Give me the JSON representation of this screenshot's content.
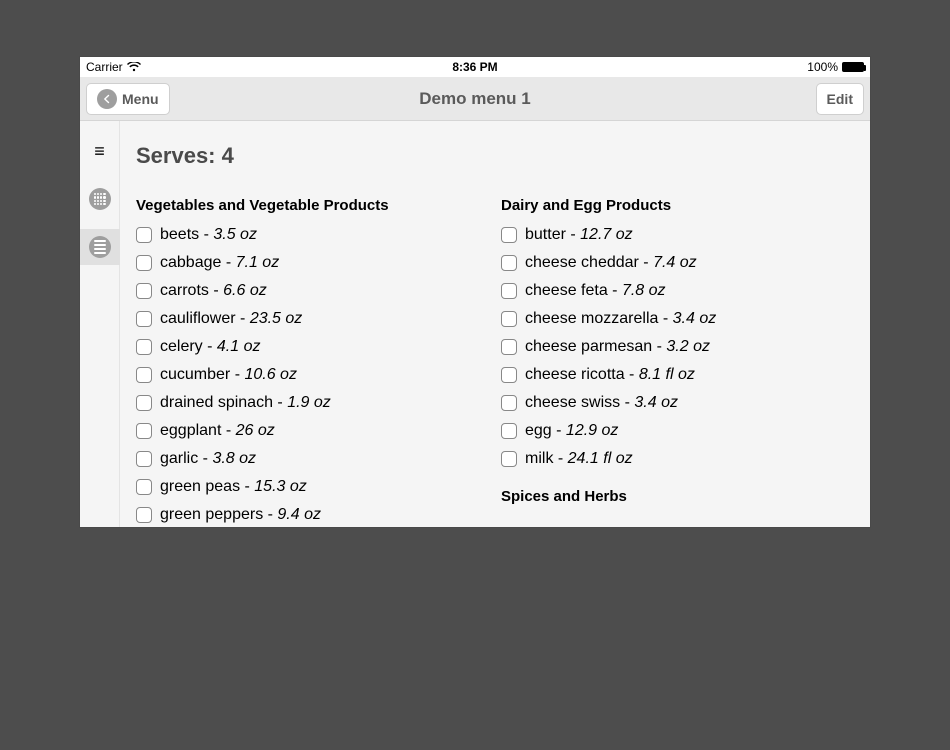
{
  "status_bar": {
    "carrier": "Carrier",
    "time": "8:36 PM",
    "battery_pct": "100%"
  },
  "nav": {
    "back_label": "Menu",
    "title": "Demo menu 1",
    "edit_label": "Edit"
  },
  "serves_label": "Serves: 4",
  "columns": [
    {
      "categories": [
        {
          "title": "Vegetables and Vegetable Products",
          "items": [
            {
              "name": "beets",
              "qty": "3.5 oz"
            },
            {
              "name": "cabbage",
              "qty": "7.1 oz"
            },
            {
              "name": "carrots",
              "qty": "6.6 oz"
            },
            {
              "name": "cauliflower",
              "qty": "23.5 oz"
            },
            {
              "name": "celery",
              "qty": "4.1 oz"
            },
            {
              "name": "cucumber",
              "qty": "10.6 oz"
            },
            {
              "name": "drained spinach",
              "qty": "1.9 oz"
            },
            {
              "name": "eggplant",
              "qty": "26 oz"
            },
            {
              "name": "garlic",
              "qty": "3.8 oz"
            },
            {
              "name": "green peas",
              "qty": "15.3 oz"
            },
            {
              "name": "green peppers",
              "qty": "9.4 oz"
            }
          ]
        }
      ]
    },
    {
      "categories": [
        {
          "title": "Dairy and Egg Products",
          "items": [
            {
              "name": "butter",
              "qty": "12.7 oz"
            },
            {
              "name": "cheese cheddar",
              "qty": "7.4 oz"
            },
            {
              "name": "cheese feta",
              "qty": "7.8 oz"
            },
            {
              "name": "cheese mozzarella",
              "qty": "3.4 oz"
            },
            {
              "name": "cheese parmesan",
              "qty": "3.2 oz"
            },
            {
              "name": "cheese ricotta",
              "qty": "8.1 fl oz"
            },
            {
              "name": "cheese swiss",
              "qty": "3.4 oz"
            },
            {
              "name": "egg",
              "qty": "12.9 oz"
            },
            {
              "name": "milk",
              "qty": "24.1 fl oz"
            }
          ]
        },
        {
          "title": "Spices and Herbs",
          "items": []
        }
      ]
    }
  ]
}
